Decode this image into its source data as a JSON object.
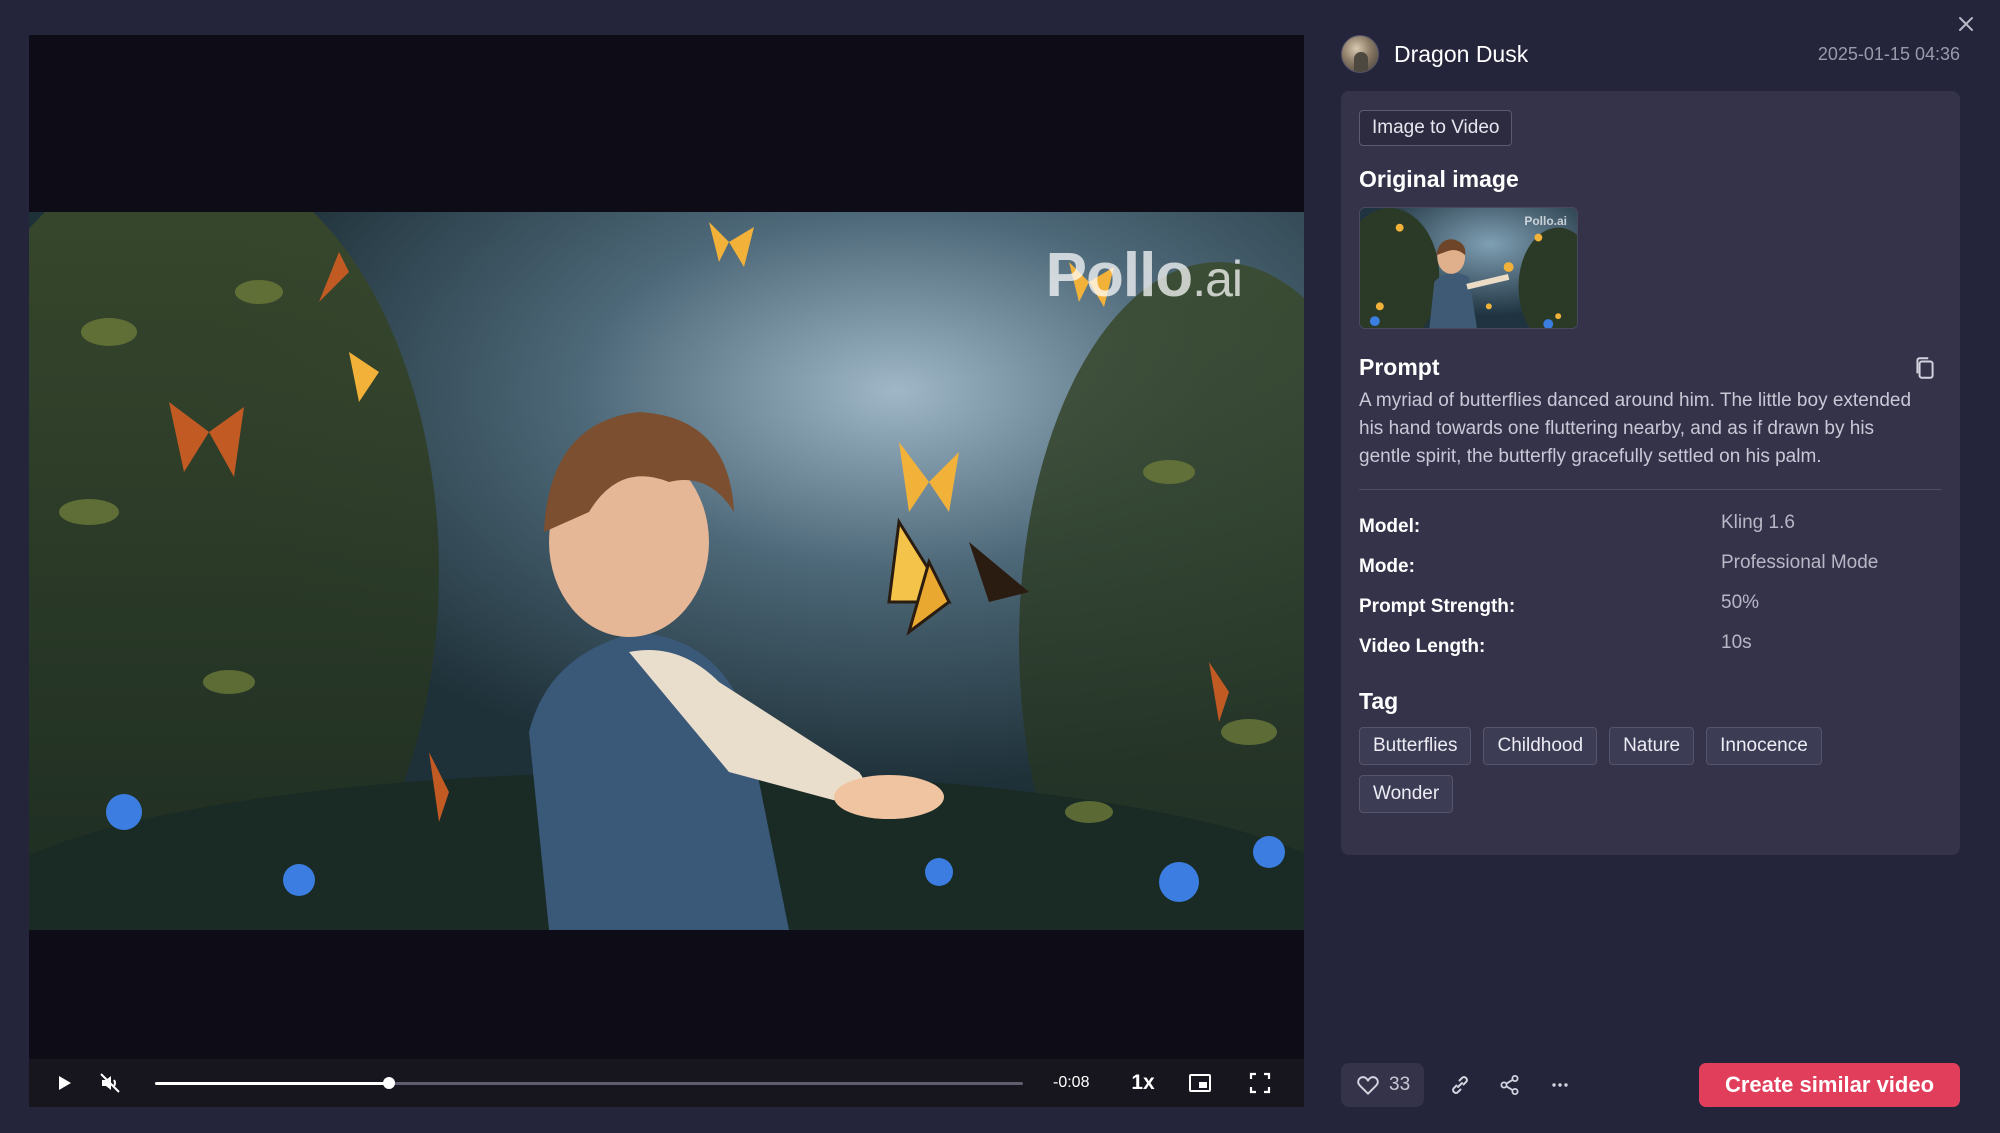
{
  "header": {
    "username": "Dragon Dusk",
    "timestamp": "2025-01-15 04:36"
  },
  "player": {
    "watermark_main": "Pollo",
    "watermark_suffix": ".ai",
    "remaining_time": "-0:08",
    "speed": "1x",
    "progress_fraction": 0.27,
    "muted": true
  },
  "details": {
    "type_badge": "Image to Video",
    "original_image_title": "Original image",
    "thumb_watermark": "Pollo.ai",
    "prompt_title": "Prompt",
    "prompt_text": "A myriad of butterflies danced around him. The little boy extended his hand towards one fluttering nearby, and as if drawn by his gentle spirit, the butterfly gracefully settled on his palm.",
    "specs": [
      {
        "key": "Model:",
        "value": "Kling 1.6"
      },
      {
        "key": "Mode:",
        "value": "Professional Mode"
      },
      {
        "key": "Prompt Strength:",
        "value": "50%"
      },
      {
        "key": "Video Length:",
        "value": "10s"
      }
    ],
    "tag_title": "Tag",
    "tags": [
      "Butterflies",
      "Childhood",
      "Nature",
      "Innocence",
      "Wonder"
    ]
  },
  "actions": {
    "like_count": "33",
    "create_label": "Create similar video"
  },
  "colors": {
    "background": "#24243a",
    "card": "#34334a",
    "accent": "#e13e5c"
  }
}
